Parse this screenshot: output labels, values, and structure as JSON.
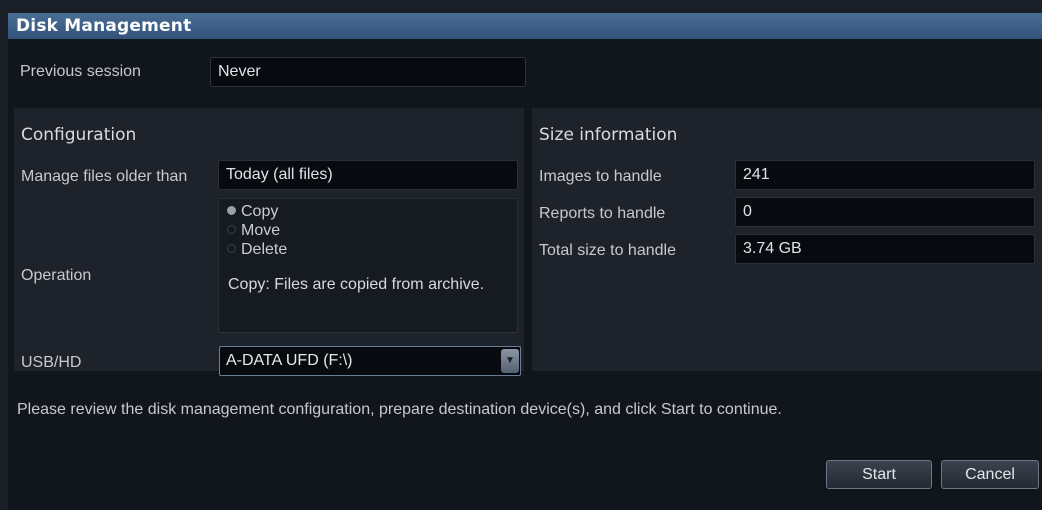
{
  "window": {
    "title": "Disk Management"
  },
  "previous_session": {
    "label": "Previous session",
    "value": "Never"
  },
  "configuration": {
    "title": "Configuration",
    "manage_files": {
      "label": "Manage files older than",
      "value": "Today (all files)"
    },
    "operation": {
      "label": "Operation",
      "options": [
        {
          "label": "Copy",
          "selected": true
        },
        {
          "label": "Move",
          "selected": false
        },
        {
          "label": "Delete",
          "selected": false
        }
      ],
      "description": "Copy: Files are copied from archive."
    },
    "usb_hd": {
      "label": "USB/HD",
      "value": "A-DATA UFD (F:\\)"
    }
  },
  "size_information": {
    "title": "Size information",
    "images": {
      "label": "Images to handle",
      "value": "241"
    },
    "reports": {
      "label": "Reports to handle",
      "value": "0"
    },
    "total": {
      "label": "Total size to handle",
      "value": "3.74 GB"
    }
  },
  "message": "Please review the disk management configuration, prepare destination device(s), and click Start to continue.",
  "buttons": {
    "start": "Start",
    "cancel": "Cancel"
  },
  "colors": {
    "title_bar": "#3d5f88",
    "background": "#11151c",
    "panel": "#1e222b"
  }
}
